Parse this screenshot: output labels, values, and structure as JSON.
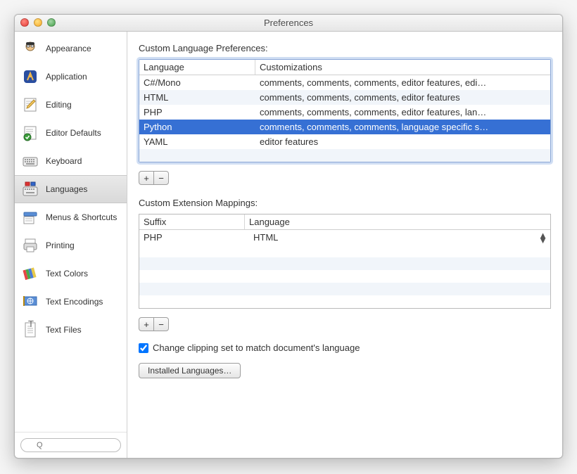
{
  "window": {
    "title": "Preferences"
  },
  "sidebar": {
    "items": [
      {
        "label": "Appearance",
        "icon": "appearance"
      },
      {
        "label": "Application",
        "icon": "app"
      },
      {
        "label": "Editing",
        "icon": "editing"
      },
      {
        "label": "Editor Defaults",
        "icon": "defaults"
      },
      {
        "label": "Keyboard",
        "icon": "keyboard"
      },
      {
        "label": "Languages",
        "icon": "languages"
      },
      {
        "label": "Menus & Shortcuts",
        "icon": "menus"
      },
      {
        "label": "Printing",
        "icon": "printing"
      },
      {
        "label": "Text Colors",
        "icon": "colors"
      },
      {
        "label": "Text Encodings",
        "icon": "encodings"
      },
      {
        "label": "Text Files",
        "icon": "files"
      }
    ],
    "selected_index": 5
  },
  "section1": {
    "title": "Custom Language Preferences:",
    "cols": [
      "Language",
      "Customizations"
    ],
    "rows": [
      {
        "lang": "C#/Mono",
        "cust": "comments, comments, comments, editor features, edi…"
      },
      {
        "lang": "HTML",
        "cust": "comments, comments, comments, editor features"
      },
      {
        "lang": "PHP",
        "cust": "comments, comments, comments, editor features, lan…"
      },
      {
        "lang": "Python",
        "cust": "comments, comments, comments, language specific s…"
      },
      {
        "lang": "YAML",
        "cust": "editor features"
      }
    ],
    "selected_index": 3,
    "add": "+",
    "remove": "−"
  },
  "section2": {
    "title": "Custom Extension Mappings:",
    "cols": [
      "Suffix",
      "Language"
    ],
    "rows": [
      {
        "suffix": "PHP",
        "lang": "HTML"
      }
    ],
    "add": "+",
    "remove": "−"
  },
  "checkbox": {
    "label": "Change clipping set to match document's language",
    "checked": true
  },
  "installed_btn": "Installed Languages…",
  "search_placeholder": "Q"
}
